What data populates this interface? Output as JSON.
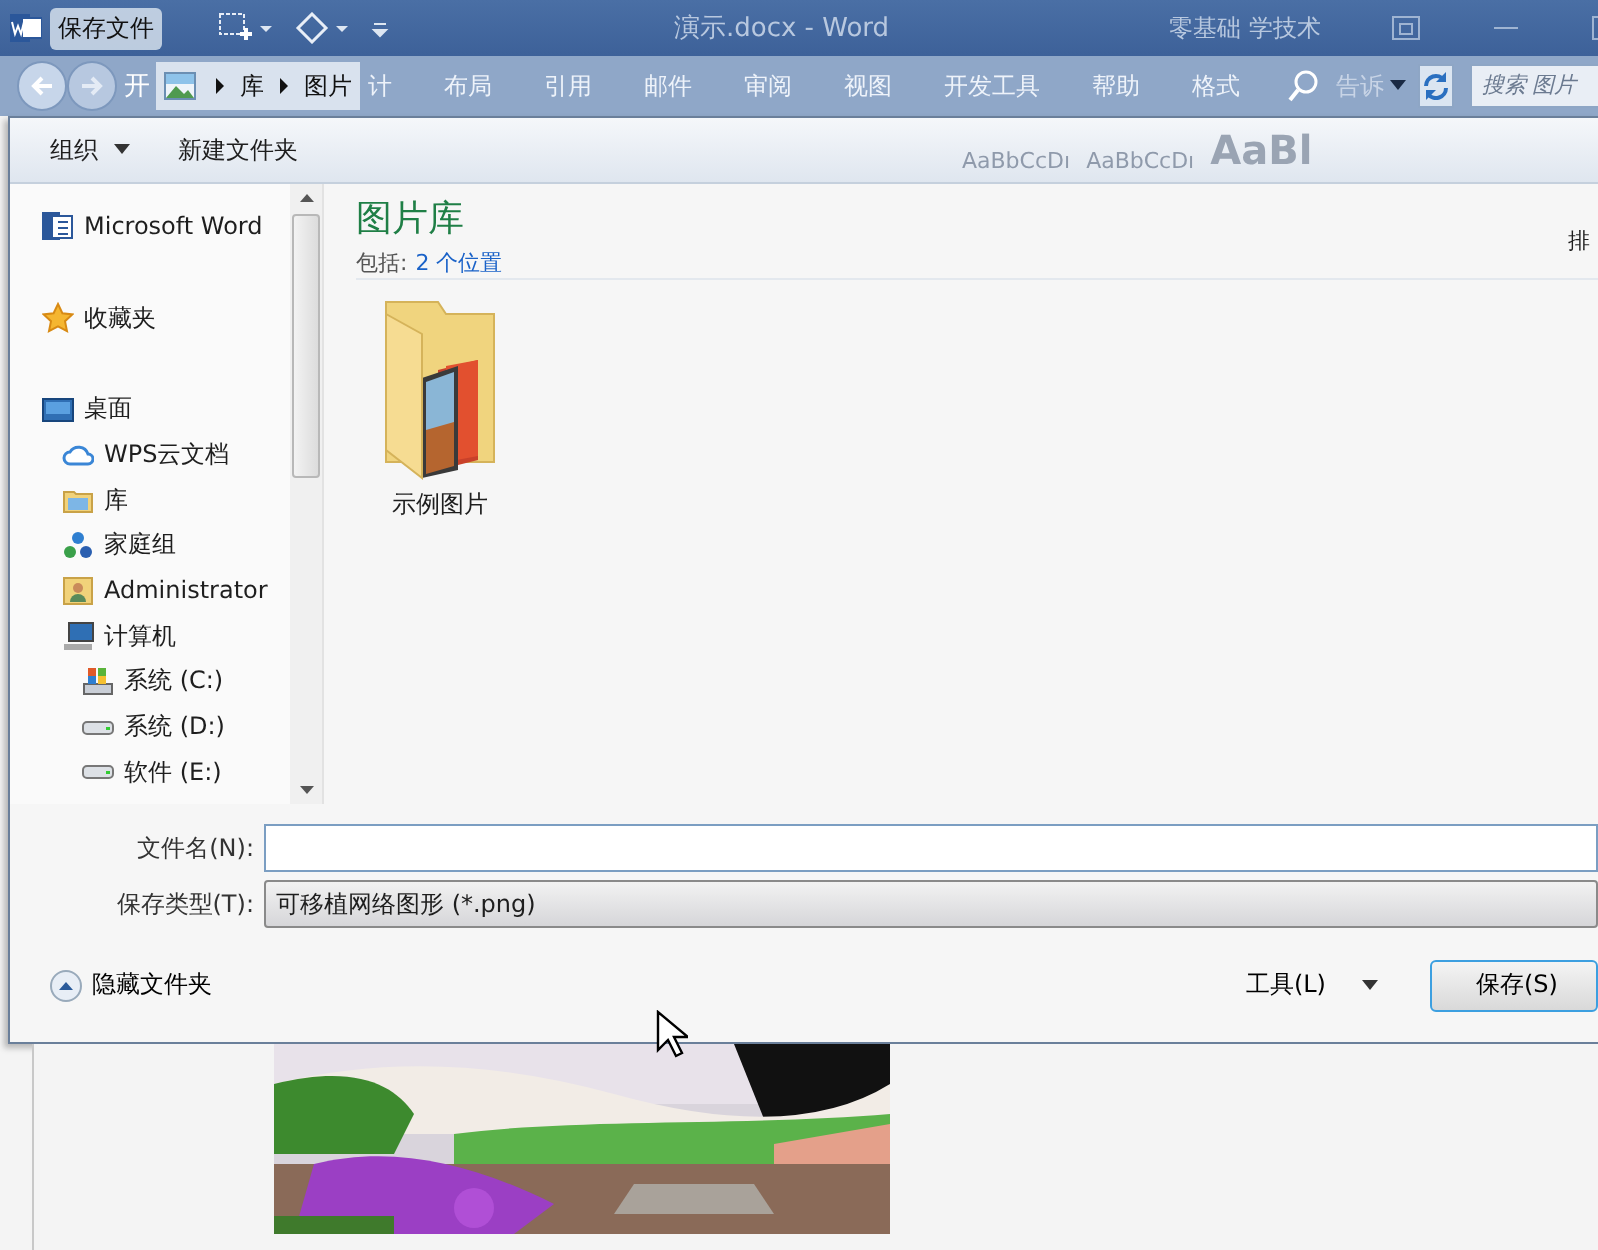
{
  "title_bar": {
    "dialog_title": "保存文件",
    "document_title": "演示.docx - Word",
    "account": "零基础 学技术"
  },
  "address_bar": {
    "start_tab": "开",
    "path": [
      {
        "label": "库"
      },
      {
        "label": "图片"
      }
    ],
    "ribbon_tabs": [
      "计",
      "布局",
      "引用",
      "邮件",
      "审阅",
      "视图",
      "开发工具",
      "帮助",
      "格式"
    ],
    "tell_me": "告诉",
    "search": {
      "placeholder": "搜索 图片"
    }
  },
  "toolbar": {
    "organize": "组织",
    "new_folder": "新建文件夹",
    "style_previews": [
      "AaBbCcDı",
      "AaBbCcDı",
      "AaBl"
    ]
  },
  "nav": {
    "items": [
      {
        "label": "Microsoft Word",
        "kind": "word"
      },
      {
        "label": "收藏夹",
        "kind": "favorites"
      },
      {
        "label": "桌面",
        "kind": "desktop",
        "children": [
          {
            "label": "WPS云文档",
            "kind": "cloud"
          },
          {
            "label": "库",
            "kind": "library"
          },
          {
            "label": "家庭组",
            "kind": "homegroup"
          },
          {
            "label": "Administrator",
            "kind": "user"
          },
          {
            "label": "计算机",
            "kind": "computer",
            "children": [
              {
                "label": "系统 (C:)",
                "kind": "system-drive"
              },
              {
                "label": "系统 (D:)",
                "kind": "drive"
              },
              {
                "label": "软件 (E:)",
                "kind": "drive"
              }
            ]
          }
        ]
      }
    ]
  },
  "library": {
    "title": "图片库",
    "includes_label": "包括:",
    "includes_link": "2 个位置",
    "sort_label": "排",
    "items": [
      {
        "label": "示例图片",
        "kind": "picture-folder"
      }
    ]
  },
  "form": {
    "file_name": {
      "label": "文件名(N):"
    },
    "save_type": {
      "label": "保存类型(T):",
      "value": "可移植网络图形 (*.png)"
    }
  },
  "footer": {
    "hide_folders": "隐藏文件夹",
    "tools": "工具(L)",
    "save": "保存(S)"
  }
}
